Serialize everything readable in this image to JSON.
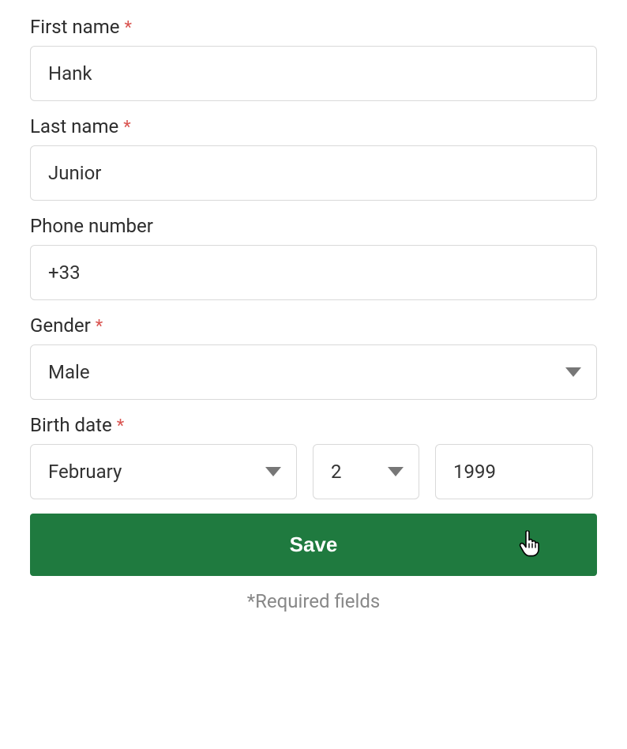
{
  "form": {
    "required_marker": "*",
    "first_name": {
      "label": "First name",
      "value": "Hank",
      "required": true
    },
    "last_name": {
      "label": "Last name",
      "value": "Junior",
      "required": true
    },
    "phone": {
      "label": "Phone number",
      "value": "+33",
      "required": false
    },
    "gender": {
      "label": "Gender",
      "value": "Male",
      "required": true
    },
    "birth_date": {
      "label": "Birth date",
      "required": true,
      "month": "February",
      "day": "2",
      "year": "1999"
    },
    "save_label": "Save",
    "required_note": "*Required fields"
  },
  "colors": {
    "primary": "#1f7a3f",
    "required": "#d9534f",
    "border": "#d9d9d9",
    "muted": "#888888"
  }
}
